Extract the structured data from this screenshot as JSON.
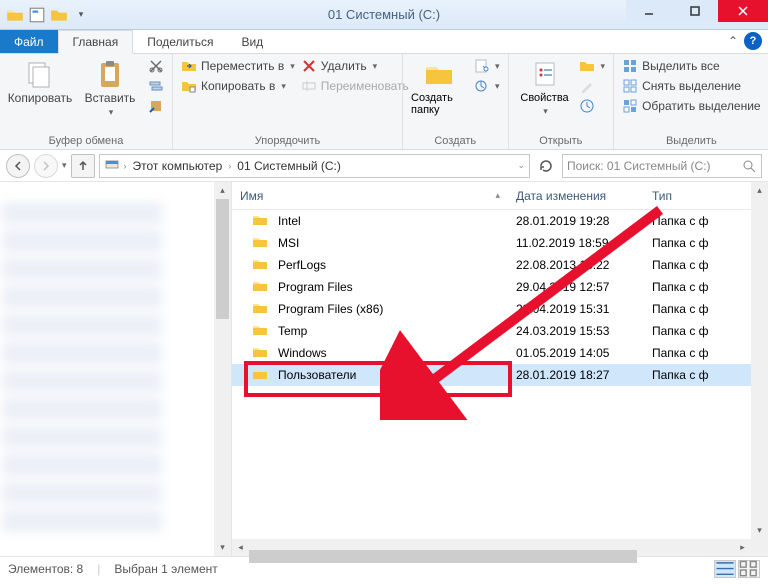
{
  "window": {
    "title": "01 Системный (C:)"
  },
  "tabs": {
    "file": "Файл",
    "home": "Главная",
    "share": "Поделиться",
    "view": "Вид"
  },
  "ribbon": {
    "clipboard": {
      "copy": "Копировать",
      "paste": "Вставить",
      "label": "Буфер обмена"
    },
    "organize": {
      "move_to": "Переместить в",
      "copy_to": "Копировать в",
      "delete": "Удалить",
      "rename": "Переименовать",
      "label": "Упорядочить"
    },
    "new": {
      "new_folder": "Создать папку",
      "label": "Создать"
    },
    "open": {
      "properties": "Свойства",
      "label": "Открыть"
    },
    "select": {
      "select_all": "Выделить все",
      "select_none": "Снять выделение",
      "invert": "Обратить выделение",
      "label": "Выделить"
    }
  },
  "breadcrumb": {
    "this_pc": "Этот компьютер",
    "drive": "01 Системный (C:)"
  },
  "search_placeholder": "Поиск: 01 Системный (C:)",
  "columns": {
    "name": "Имя",
    "date": "Дата изменения",
    "type": "Тип"
  },
  "type_value": "Папка с ф",
  "files": [
    {
      "name": "Intel",
      "date": "28.01.2019 19:28"
    },
    {
      "name": "MSI",
      "date": "11.02.2019 18:59"
    },
    {
      "name": "PerfLogs",
      "date": "22.08.2013 18:22"
    },
    {
      "name": "Program Files",
      "date": "29.04.2019 12:57"
    },
    {
      "name": "Program Files (x86)",
      "date": "23.04.2019 15:31"
    },
    {
      "name": "Temp",
      "date": "24.03.2019 15:53"
    },
    {
      "name": "Windows",
      "date": "01.05.2019 14:05"
    },
    {
      "name": "Пользователи",
      "date": "28.01.2019 18:27"
    }
  ],
  "status": {
    "count": "Элементов: 8",
    "selected": "Выбран 1 элемент"
  }
}
